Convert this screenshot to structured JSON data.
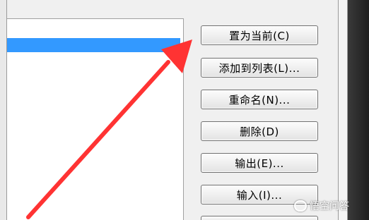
{
  "buttons": {
    "set_current": "置为当前(C)",
    "add_to_list": "添加到列表(L)...",
    "rename": "重命名(N)...",
    "delete": "删除(D)",
    "export": "输出(E)...",
    "import": "输入(I)..."
  },
  "watermark": {
    "text": "悟空问答"
  },
  "colors": {
    "selection": "#3399ff",
    "arrow": "#ff3333"
  }
}
